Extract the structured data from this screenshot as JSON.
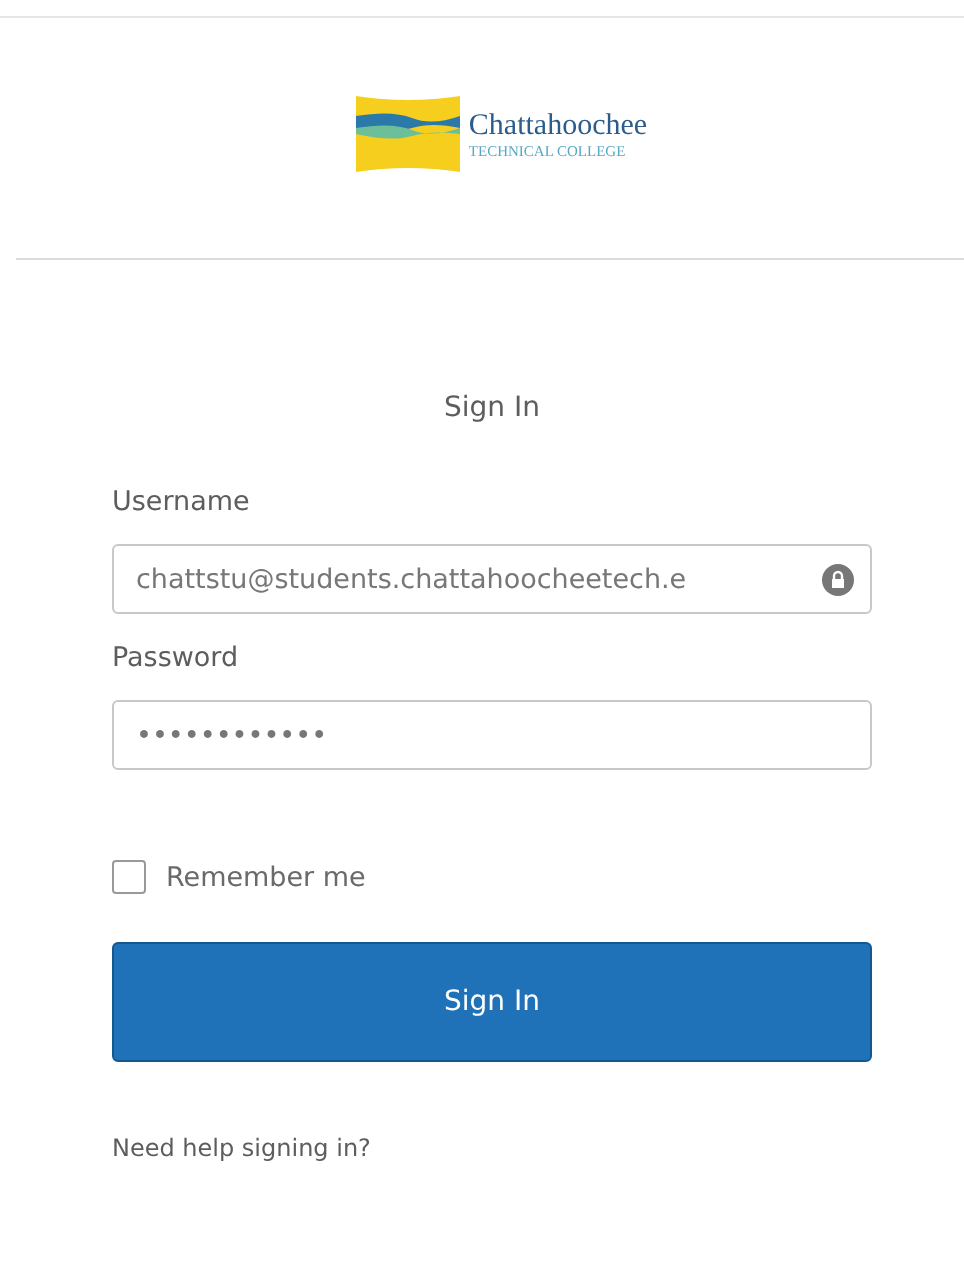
{
  "logo": {
    "name": "Chattahoochee",
    "subtitle": "TECHNICAL COLLEGE"
  },
  "title": "Sign In",
  "username": {
    "label": "Username",
    "value": "chattstu@students.chattahoocheetech.e"
  },
  "password": {
    "label": "Password",
    "value": "••••••••••••"
  },
  "remember": {
    "label": "Remember me",
    "checked": false
  },
  "submit": "Sign In",
  "help_link": "Need help signing in?"
}
